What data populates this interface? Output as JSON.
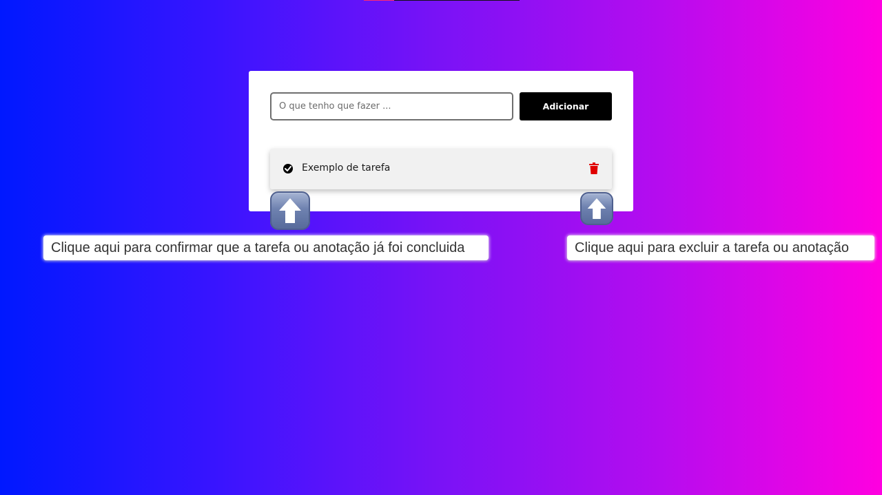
{
  "form": {
    "input_placeholder": "O que tenho que fazer ...",
    "input_value": "",
    "add_button_label": "Adicionar"
  },
  "tasks": [
    {
      "text": "Exemplo de tarefa",
      "complete_icon": "check-circle-icon",
      "delete_icon": "trash-icon"
    }
  ],
  "tutorial": {
    "arrow_icon": "arrow-up-icon",
    "complete_hint": "Clique aqui para confirmar que a tarefa ou anotação já foi concluida",
    "delete_hint": "Clique aqui para excluir a tarefa ou anotação"
  },
  "colors": {
    "background_start": "#0018ff",
    "background_end": "#ff00e0",
    "button_bg": "#000000",
    "delete_icon": "#e00000",
    "card_bg": "#ffffff"
  }
}
